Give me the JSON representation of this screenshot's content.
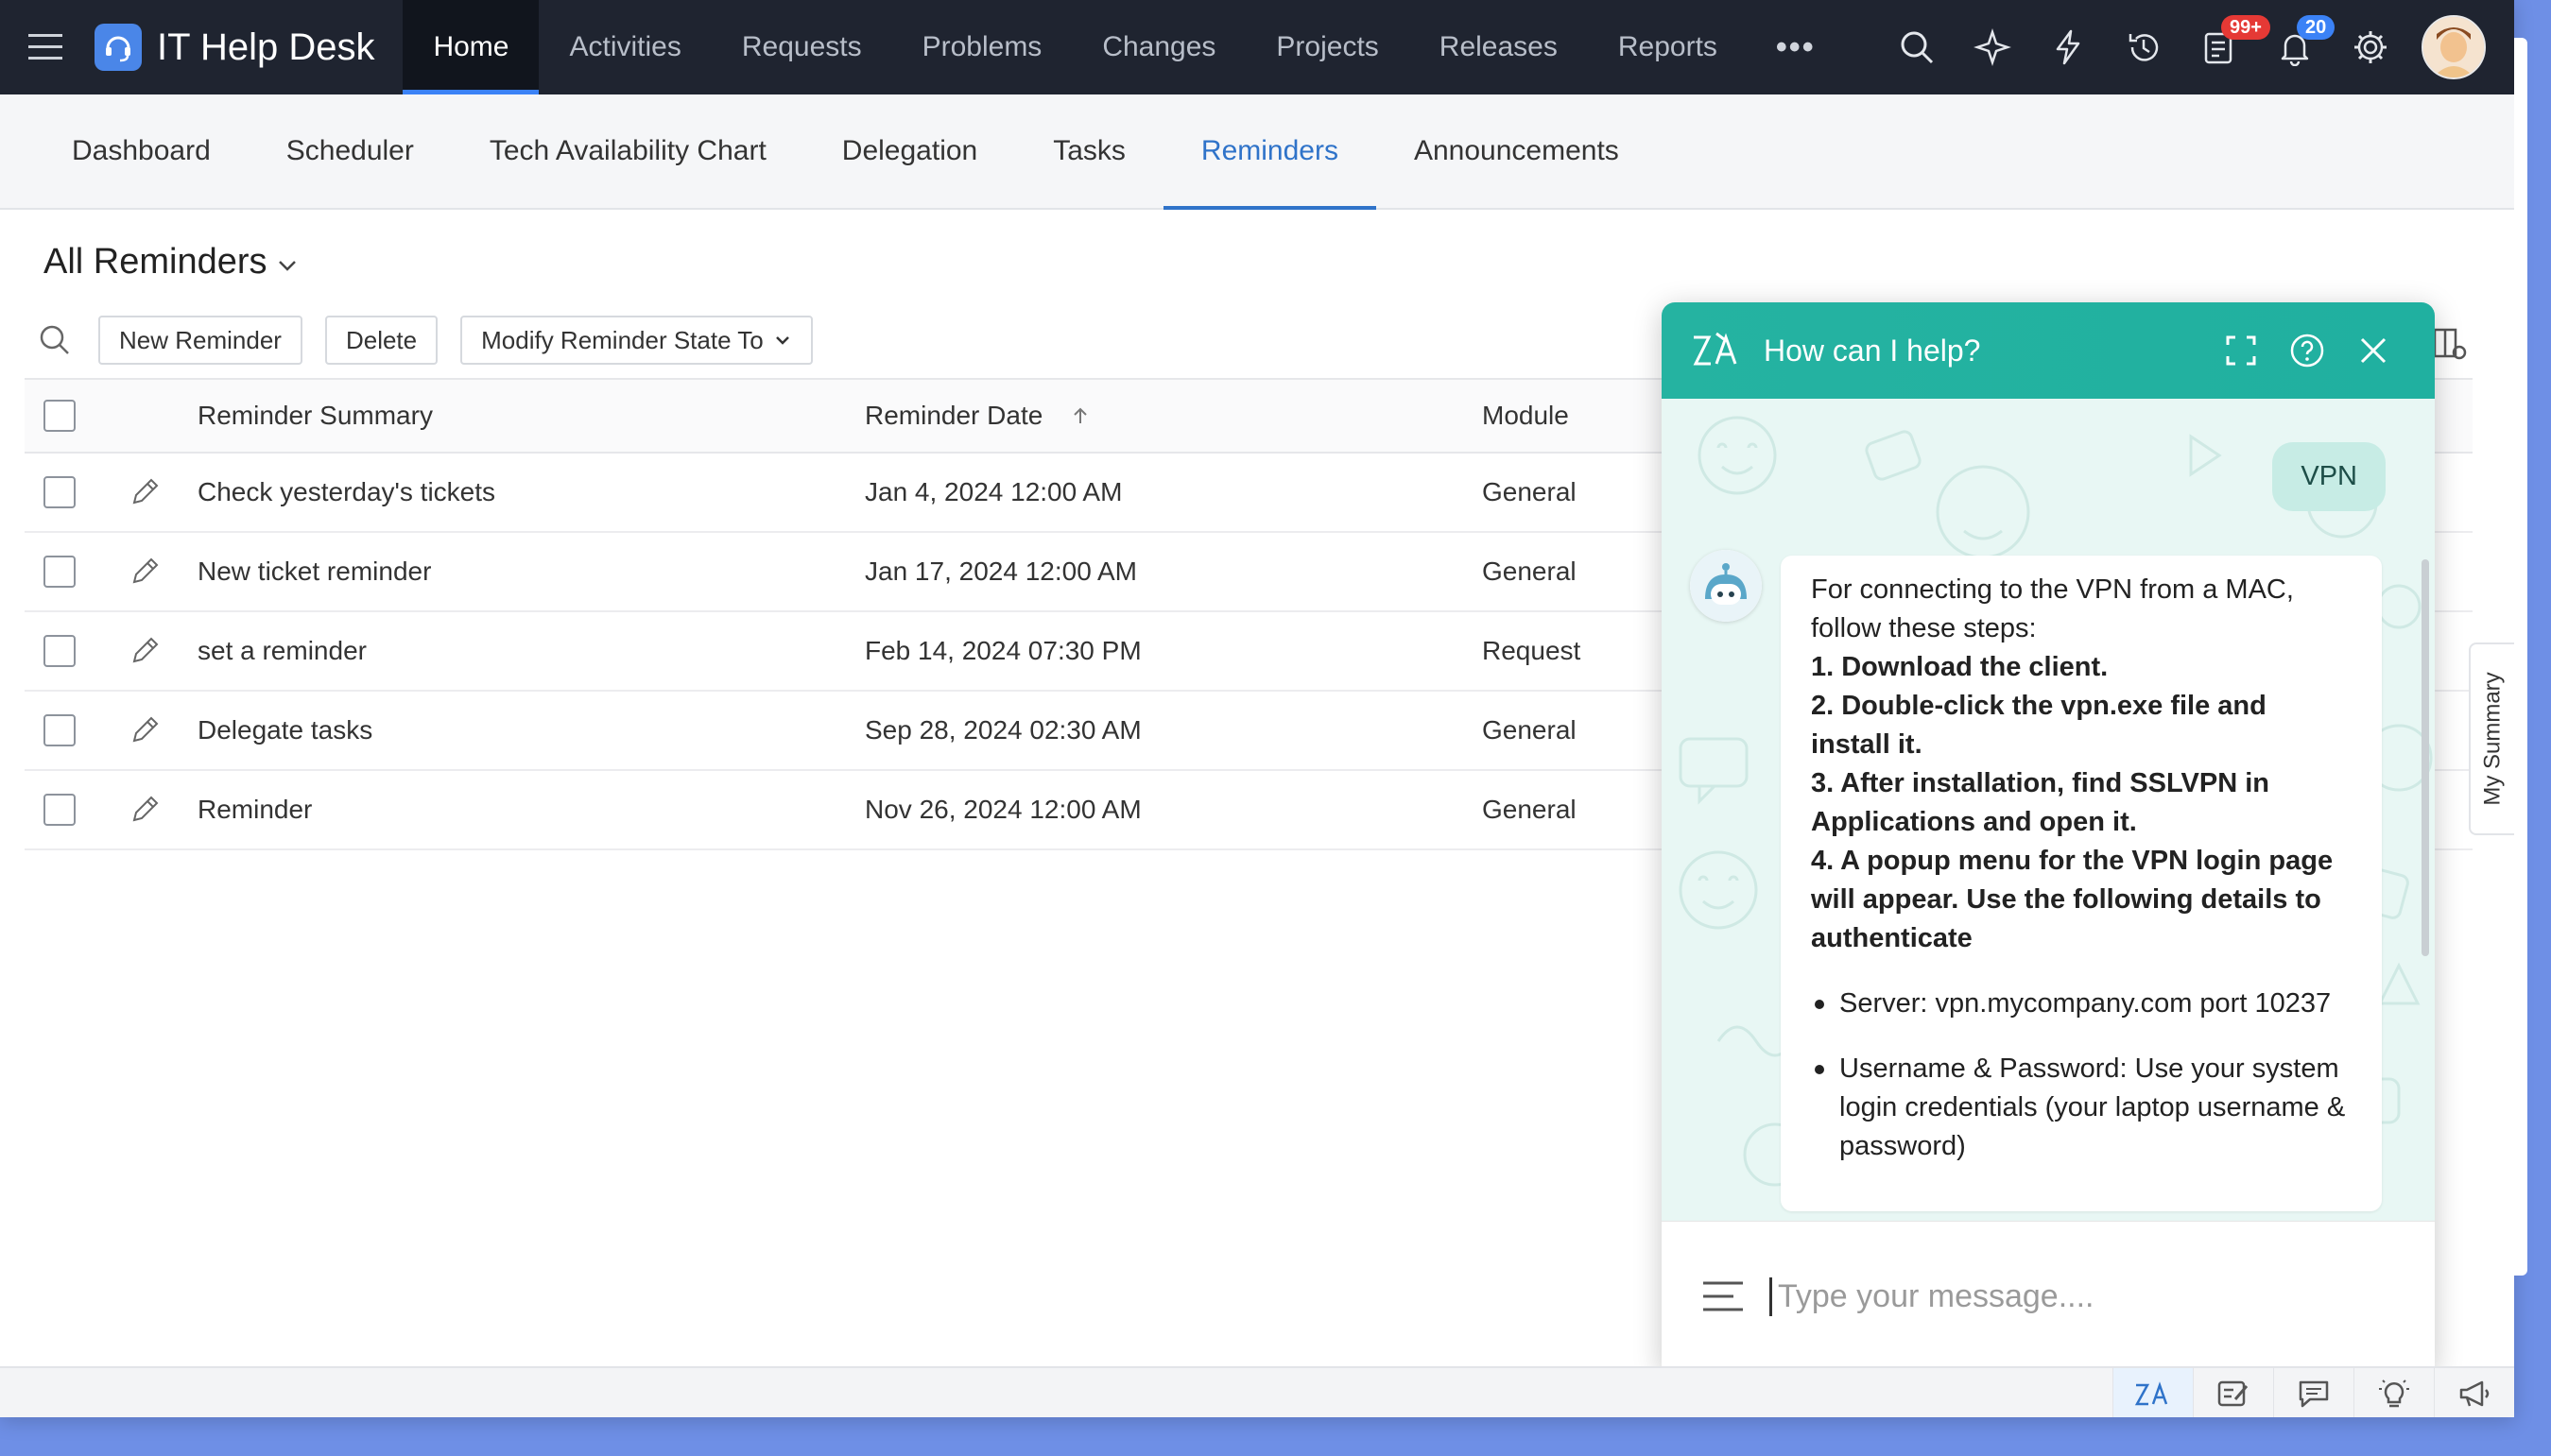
{
  "app": {
    "brand": "IT Help Desk",
    "nav": [
      "Home",
      "Activities",
      "Requests",
      "Problems",
      "Changes",
      "Projects",
      "Releases",
      "Reports"
    ],
    "more": "•••",
    "badges": {
      "tasks": "99+",
      "notifications": "20"
    },
    "icons": [
      "search-icon",
      "magic-icon",
      "lightning-icon",
      "history-icon",
      "tasks-icon",
      "bell-icon",
      "gear-icon"
    ]
  },
  "subnav": [
    "Dashboard",
    "Scheduler",
    "Tech Availability Chart",
    "Delegation",
    "Tasks",
    "Reminders",
    "Announcements"
  ],
  "page": {
    "title": "All Reminders",
    "toolbar": {
      "new": "New Reminder",
      "delete": "Delete",
      "modify": "Modify Reminder State To"
    }
  },
  "table": {
    "headers": {
      "summary": "Reminder Summary",
      "date": "Reminder Date",
      "module": "Module"
    },
    "rows": [
      {
        "summary": "Check yesterday's tickets",
        "date": "Jan 4, 2024 12:00 AM",
        "module": "General"
      },
      {
        "summary": "New ticket reminder",
        "date": "Jan 17, 2024 12:00 AM",
        "module": "General"
      },
      {
        "summary": "set a reminder",
        "date": "Feb 14, 2024 07:30 PM",
        "module": "Request"
      },
      {
        "summary": "Delegate tasks",
        "date": "Sep 28, 2024 02:30 AM",
        "module": "General"
      },
      {
        "summary": "Reminder",
        "date": "Nov 26, 2024 12:00 AM",
        "module": "General"
      }
    ]
  },
  "chat": {
    "title": "How can I help?",
    "user_message": "VPN",
    "bot": {
      "intro": "For connecting to the VPN from a MAC, follow these steps:",
      "steps": [
        "1. Download the client.",
        "2. Double-click the vpn.exe file and install it.",
        "3. After installation, find SSLVPN in Applications and open it.",
        "4. A popup menu for the VPN login page will appear. Use the following details to authenticate"
      ],
      "bullets": [
        "Server: vpn.mycompany.com port 10237",
        "Username & Password: Use your system login credentials (your laptop username & password)"
      ]
    },
    "input_placeholder": "Type your message...."
  },
  "side_tab": "My Summary",
  "colors": {
    "nav_bg": "#1f2430",
    "accent": "#3b82f6",
    "chat_teal": "#25b3a1",
    "link_blue": "#2f73c9"
  }
}
